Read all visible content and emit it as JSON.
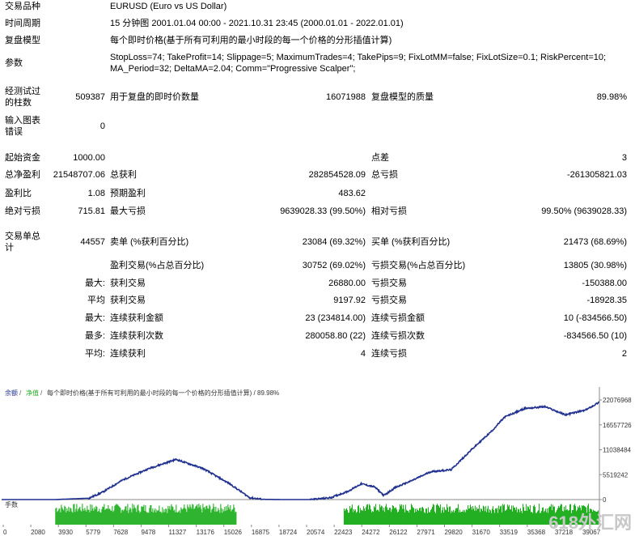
{
  "report": {
    "symbol_label": "交易品种",
    "symbol_value": "EURUSD (Euro vs US Dollar)",
    "period_label": "时间周期",
    "period_value": "15 分钟图 2001.01.04 00:00 - 2021.10.31 23:45 (2000.01.01 - 2022.01.01)",
    "model_label": "复盘模型",
    "model_value": "每个即时价格(基于所有可利用的最小时段的每一个价格的分形插值计算)",
    "params_label": "参数",
    "params_line1": "StopLoss=74; TakeProfit=14; Slippage=5; MaximumTrades=4; TakePips=9; FixLotMM=false; FixLotSize=0.1; RiskPercent=10;",
    "params_line2": "MA_Period=32; DeltaMA=2.04; Comm=\"Progressive Scalper\";"
  },
  "stats": {
    "bars_label_1": "经测试过",
    "bars_label_2": "的柱数",
    "bars_value": "509387",
    "ticks_label": "用于复盘的即时价数量",
    "ticks_value": "16071988",
    "quality_label": "复盘模型的质量",
    "quality_value": "89.98%",
    "errors_label_1": "输入图表",
    "errors_label_2": "错误",
    "errors_value": "0",
    "deposit_label": "起始资金",
    "deposit_value": "1000.00",
    "spread_label": "点差",
    "spread_value": "3",
    "net_label": "总净盈利",
    "net_value": "21548707.06",
    "gross_profit_label": "总获利",
    "gross_profit_value": "282854528.09",
    "gross_loss_label": "总亏损",
    "gross_loss_value": "-261305821.03",
    "pf_label": "盈利比",
    "pf_value": "1.08",
    "expected_label": "预期盈利",
    "expected_value": "483.62",
    "abs_dd_label": "绝对亏损",
    "abs_dd_value": "715.81",
    "max_dd_label": "最大亏损",
    "max_dd_value": "9639028.33 (99.50%)",
    "rel_dd_label": "相对亏损",
    "rel_dd_value": "99.50% (9639028.33)",
    "trades_label_1": "交易单总",
    "trades_label_2": "计",
    "trades_value": "44557",
    "short_label": "卖单 (%获利百分比)",
    "short_value": "23084 (69.32%)",
    "long_label": "买单 (%获利百分比)",
    "long_value": "21473 (68.69%)",
    "profit_trades_label": "盈利交易(%占总百分比)",
    "profit_trades_value": "30752 (69.02%)",
    "loss_trades_label": "亏损交易(%占总百分比)",
    "loss_trades_value": "13805 (30.98%)",
    "largest_label": "最大:",
    "largest_profit_label": "获利交易",
    "largest_profit_value": "26880.00",
    "largest_loss_label": "亏损交易",
    "largest_loss_value": "-150388.00",
    "average_label": "平均",
    "avg_profit_label": "获利交易",
    "avg_profit_value": "9197.92",
    "avg_loss_label": "亏损交易",
    "avg_loss_value": "-18928.35",
    "max_label": "最大:",
    "max_cons_wins_label": "连续获利金额",
    "max_cons_wins_value": "23 (234814.00)",
    "max_cons_losses_label": "连续亏损金额",
    "max_cons_losses_value": "10 (-834566.50)",
    "maximal_label": "最多:",
    "max_cons_profit_label": "连续获利次数",
    "max_cons_profit_value": "280058.80 (22)",
    "max_cons_loss_label": "连续亏损次数",
    "max_cons_loss_value": "-834566.50 (10)",
    "avg2_label": "平均:",
    "avg_cons_wins_label": "连续获利",
    "avg_cons_wins_value": "4",
    "avg_cons_losses_label": "连续亏损",
    "avg_cons_losses_value": "2"
  },
  "chart_data": {
    "type": "line",
    "legend_balance": "余额",
    "legend_equity": "净值",
    "legend_rest": "每个即时价格(基于所有可利用的最小时段的每一个价格的分形插值计算) / 89.98%",
    "volume_label": "手数",
    "ylim": [
      0,
      22076968
    ],
    "yticks": [
      "22076968",
      "16557726",
      "11038484",
      "5519242",
      "0"
    ],
    "ytick_values": [
      22076968,
      16557726,
      11038484,
      5519242,
      0
    ],
    "xticks": [
      "0",
      "2080",
      "3930",
      "5779",
      "7628",
      "9478",
      "11327",
      "13176",
      "15026",
      "16875",
      "18724",
      "20574",
      "22423",
      "24272",
      "26122",
      "27971",
      "29820",
      "31670",
      "33519",
      "35368",
      "37218",
      "39067"
    ],
    "xlim": [
      0,
      44557
    ],
    "x": [
      0,
      4000,
      6500,
      7500,
      9000,
      11000,
      13000,
      15000,
      17000,
      18500,
      19500,
      21000,
      23000,
      24500,
      25800,
      26800,
      27800,
      28500,
      29300,
      30500,
      32000,
      33500,
      35000,
      36500,
      37500,
      39000,
      40500,
      42000,
      43500,
      44557
    ],
    "values": [
      0,
      0,
      300000,
      1600000,
      4300000,
      6900000,
      8900000,
      6900000,
      3500000,
      400000,
      50000,
      0,
      0,
      400000,
      1800000,
      3500000,
      2800000,
      900000,
      2600000,
      4100000,
      6200000,
      6600000,
      11000000,
      15100000,
      18300000,
      20200000,
      20600000,
      18800000,
      19800000,
      21600000
    ],
    "volume_segments": [
      [
        4000,
        17500
      ],
      [
        25500,
        44557
      ]
    ]
  },
  "watermark": "618外汇网",
  "colors": {
    "balance": "#1e2f8f",
    "volume": "#22b022",
    "grid": "#aaaaaa",
    "legend_balance": "#1e2f8f",
    "legend_equity": "#22b022"
  }
}
